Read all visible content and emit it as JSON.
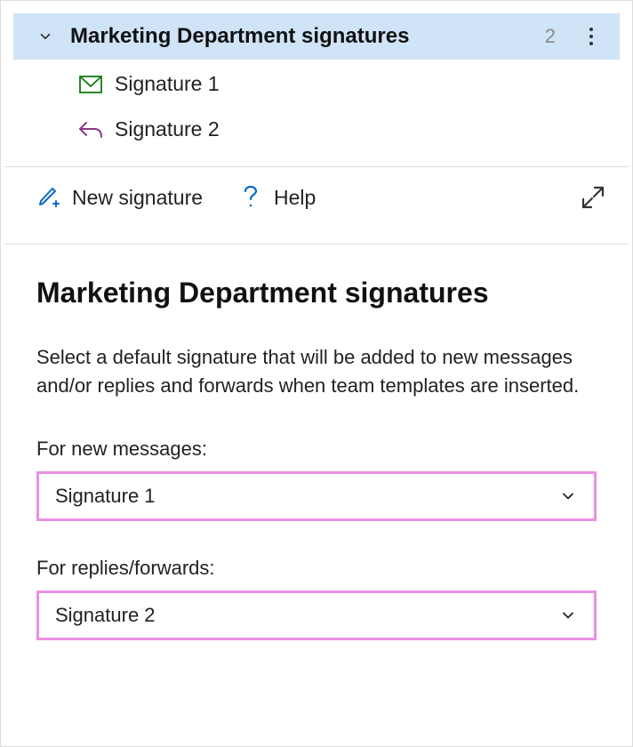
{
  "group": {
    "title": "Marketing Department signatures",
    "count": "2",
    "items": [
      {
        "label": "Signature 1",
        "icon": "mail"
      },
      {
        "label": "Signature 2",
        "icon": "reply"
      }
    ]
  },
  "toolbar": {
    "new_signature": "New signature",
    "help": "Help"
  },
  "main": {
    "heading": "Marketing Department signatures",
    "description": "Select a default signature that will be added to new messages and/or replies and forwards when team templates are inserted.",
    "fields": {
      "new_messages": {
        "label": "For new messages:",
        "value": "Signature 1"
      },
      "replies_forwards": {
        "label": "For replies/forwards:",
        "value": "Signature 2"
      }
    }
  }
}
